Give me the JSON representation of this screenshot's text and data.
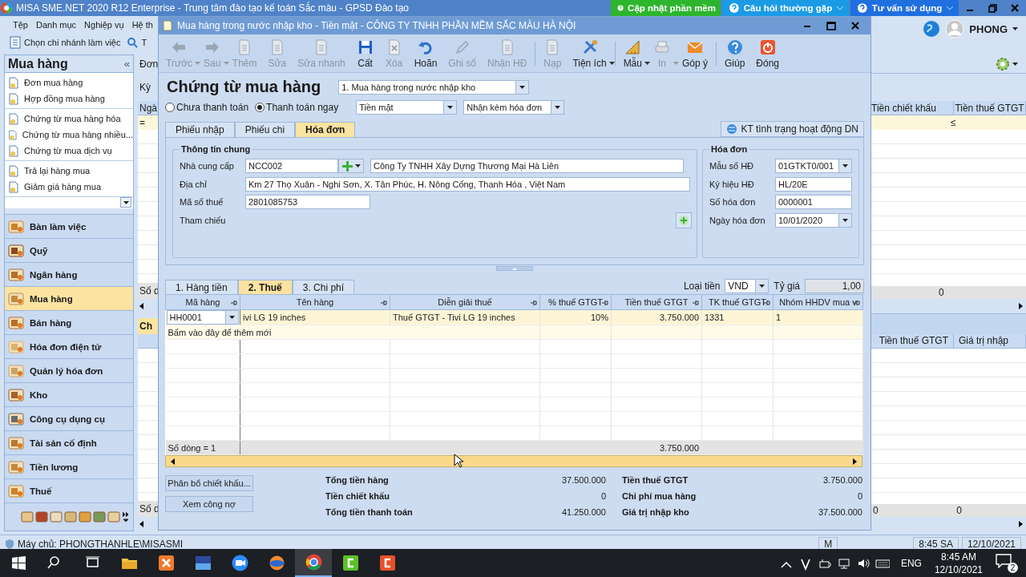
{
  "app": {
    "title": "MISA SME.NET 2020 R12 Enterprise - Trung tâm đào tạo kế toán Sắc màu - GPSD Đào tạo",
    "top_buttons": [
      {
        "label": "Cập nhật phần mềm",
        "color": "#2db52d"
      },
      {
        "label": "Câu hỏi thường gặp",
        "color": "#1b9be6"
      },
      {
        "label": "Tư vấn sử dụng",
        "color": "#1f6fdf"
      }
    ],
    "menu": [
      "Tệp",
      "Danh mục",
      "Nghiệp vụ",
      "Hệ th"
    ],
    "branch_button": "Chọn chi nhánh làm việc",
    "toolbar_fragment": "T",
    "user": "PHONG"
  },
  "sidebar": {
    "title": "Mua hàng",
    "collapse": "«",
    "groups": [
      [
        "Đơn mua hàng",
        "Hợp đồng mua hàng"
      ],
      [
        "Chứng từ mua hàng hóa",
        "Chứng từ mua hàng nhiều...",
        "Chứng từ mua dịch vụ"
      ],
      [
        "Trả lại hàng mua",
        "Giảm giá hàng mua"
      ]
    ],
    "modules": [
      {
        "label": "Bàn làm việc",
        "selected": false
      },
      {
        "label": "Quỹ",
        "selected": false
      },
      {
        "label": "Ngân hàng",
        "selected": false
      },
      {
        "label": "Mua hàng",
        "selected": true
      },
      {
        "label": "Bán hàng",
        "selected": false
      },
      {
        "label": "Hóa đơn điện tử",
        "selected": false
      },
      {
        "label": "Quản lý hóa đơn",
        "selected": false
      },
      {
        "label": "Kho",
        "selected": false
      },
      {
        "label": "Công cụ dụng cụ",
        "selected": false
      },
      {
        "label": "Tài sản cố định",
        "selected": false
      },
      {
        "label": "Tiền lương",
        "selected": false
      },
      {
        "label": "Thuế",
        "selected": false
      }
    ]
  },
  "background": {
    "left_tab": "Đơn",
    "left_period": "Kỳ",
    "left_header": "Ngà",
    "left_filter": "=",
    "left_footer": "Số d",
    "left_tab_2": "Ch",
    "left_footer_2": "Số d",
    "right_columns": [
      "Tiền chiết khấu",
      "Tiền thuế GTGT"
    ],
    "right_filter": "≤",
    "right_footer": "0",
    "right_columns_2": [
      "Tiền thuế GTGT",
      "Giá trị nhập"
    ],
    "right_footer_2": [
      "0",
      "0"
    ]
  },
  "status_bar": {
    "server": "Máy chủ: PHONGTHANHLE\\MISASMI",
    "cells": [
      "M",
      "8:45 SA",
      "12/10/2021"
    ]
  },
  "dialog": {
    "title": "Mua hàng trong nước nhập kho - Tiền mặt - CÔNG TY TNHH PHẦN MỀM SẮC MÀU HÀ NỘI",
    "toolbar": [
      {
        "label": "Trước",
        "disabled": true,
        "dropdown": true
      },
      {
        "label": "Sau",
        "disabled": true,
        "dropdown": true
      },
      {
        "label": "Thêm",
        "disabled": true,
        "dropdown": false
      },
      {
        "label": "Sửa",
        "disabled": true,
        "dropdown": false
      },
      {
        "label": "Sửa nhanh",
        "disabled": true,
        "dropdown": false
      },
      {
        "label": "Cất",
        "disabled": false,
        "dropdown": false
      },
      {
        "label": "Xóa",
        "disabled": true,
        "dropdown": false
      },
      {
        "label": "Hoãn",
        "disabled": false,
        "dropdown": false
      },
      {
        "label": "Ghi sổ",
        "disabled": true,
        "dropdown": false
      },
      {
        "label": "Nhận HĐ",
        "disabled": true,
        "dropdown": false
      },
      {
        "label": "Nạp",
        "disabled": true,
        "dropdown": false
      },
      {
        "label": "Tiện ích",
        "disabled": false,
        "dropdown": true
      },
      {
        "label": "Mẫu",
        "disabled": false,
        "dropdown": true
      },
      {
        "label": "In",
        "disabled": true,
        "dropdown": true
      },
      {
        "label": "Góp ý",
        "disabled": false,
        "dropdown": false
      },
      {
        "label": "Giúp",
        "disabled": false,
        "dropdown": false
      },
      {
        "label": "Đóng",
        "disabled": false,
        "dropdown": false
      }
    ],
    "heading": "Chứng từ mua hàng",
    "voucher_type": "1. Mua hàng trong nước nhập kho",
    "radios": [
      {
        "label": "Chưa thanh toán",
        "selected": false
      },
      {
        "label": "Thanh toán ngay",
        "selected": true
      }
    ],
    "payment_method": "Tiền mặt",
    "invoice_option": "Nhận kèm hóa đơn",
    "tabs": [
      {
        "label": "Phiếu nhập",
        "selected": false
      },
      {
        "label": "Phiếu chi",
        "selected": false
      },
      {
        "label": "Hóa đơn",
        "selected": true
      }
    ],
    "check_button": "KT tình trạng hoạt động DN",
    "general": {
      "title": "Thông tin chung",
      "supplier_label": "Nhà cung cấp",
      "supplier_code": "NCC002",
      "supplier_name": "Công Ty TNHH Xây Dựng Thương Mại Hà Liên",
      "address_label": "Địa chỉ",
      "address": "Km 27 Thọ Xuân - Nghi Sơn, X. Tân Phúc, H. Nông Cống, Thanh Hóa , Việt Nam",
      "tax_label": "Mã số thuế",
      "tax_code": "2801085753",
      "reference_label": "Tham chiếu"
    },
    "invoice": {
      "title": "Hóa đơn",
      "fields": [
        {
          "label": "Mẫu số HĐ",
          "value": "01GTKT0/001",
          "kind": "select"
        },
        {
          "label": "Ký hiệu HĐ",
          "value": "HL/20E",
          "kind": "text"
        },
        {
          "label": "Số hóa đơn",
          "value": "0000001",
          "kind": "text"
        },
        {
          "label": "Ngày hóa đơn",
          "value": "10/01/2020",
          "kind": "select"
        }
      ]
    },
    "detail_tabs": [
      {
        "label": "1. Hàng tiền",
        "selected": false
      },
      {
        "label": "2. Thuế",
        "selected": true
      },
      {
        "label": "3. Chi phí",
        "selected": false
      }
    ],
    "currency_label": "Loại tiền",
    "currency": "VND",
    "rate_label": "Tỷ giá",
    "rate": "1,00",
    "table": {
      "columns": [
        "Mã hàng",
        "Tên hàng",
        "Diễn giải thuế",
        "% thuế GTGT",
        "Tiền thuế GTGT",
        "TK thuế GTGT",
        "Nhóm HHDV mua v"
      ],
      "rows": [
        [
          "HH0001",
          "ivi LG 19 inches",
          "Thuế GTGT - Tivi LG 19 inches",
          "10%",
          "3.750.000",
          "1331",
          "1"
        ]
      ],
      "add_row": "Bấm vào đây để thêm mới",
      "row_count": "Số dòng = 1",
      "total_tax": "3.750.000"
    },
    "buttons": [
      "Phân bổ chiết khấu...",
      "Xem công nợ"
    ],
    "totals_left": [
      {
        "label": "Tổng tiền hàng",
        "value": "37.500.000"
      },
      {
        "label": "Tiền chiết khấu",
        "value": "0"
      },
      {
        "label": "Tổng tiền thanh toán",
        "value": "41.250.000"
      }
    ],
    "totals_right": [
      {
        "label": "Tiền thuế GTGT",
        "value": "3.750.000"
      },
      {
        "label": "Chi phí mua hàng",
        "value": "0"
      },
      {
        "label": "Giá trị nhập kho",
        "value": "37.500.000"
      }
    ]
  },
  "taskbar": {
    "language": "ENG",
    "time": "8:45 AM",
    "date": "12/10/2021",
    "notifications": "2"
  }
}
